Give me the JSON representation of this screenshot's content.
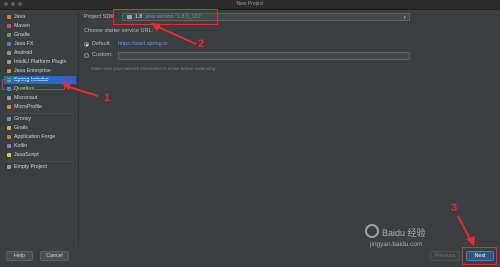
{
  "window": {
    "title": "New Project"
  },
  "sidebar": {
    "items": [
      {
        "label": "Java",
        "color": "#c8843a"
      },
      {
        "label": "Maven",
        "color": "#b85a6e"
      },
      {
        "label": "Gradle",
        "color": "#5a9a6e"
      },
      {
        "label": "Java FX",
        "color": "#5a7ab8"
      },
      {
        "label": "Android",
        "color": "#7ab04a"
      },
      {
        "label": "IntelliJ Platform Plugin",
        "color": "#9a9a9a"
      },
      {
        "label": "Java Enterprise",
        "color": "#d08a3a"
      },
      {
        "label": "Spring Initializr",
        "color": "#6db33f"
      },
      {
        "label": "Quarkus",
        "color": "#4695eb"
      },
      {
        "label": "Micronaut",
        "color": "#9a9a9a"
      },
      {
        "label": "MicroProfile",
        "color": "#d08a3a"
      },
      {
        "label": "Groovy",
        "color": "#5a9ab8"
      },
      {
        "label": "Grails",
        "color": "#d0b03a"
      },
      {
        "label": "Application Forge",
        "color": "#c8843a"
      },
      {
        "label": "Kotlin",
        "color": "#a06ad0"
      },
      {
        "label": "JavaScript",
        "color": "#d0c83a"
      },
      {
        "label": "Empty Project",
        "color": "#9a9a9a"
      }
    ],
    "selected": "Spring Initializr"
  },
  "main": {
    "sdk_label": "Project SDK:",
    "sdk_name": "1.8",
    "sdk_version": "java version \"1.8.0_131\"",
    "starter_label": "Choose starter service URL:",
    "default_label": "Default:",
    "default_url": "https://start.spring.io",
    "custom_label": "Custom:",
    "custom_value": "",
    "note": "Make sure your network connection is active before continuing."
  },
  "buttons": {
    "help": "Help",
    "cancel": "Cancel",
    "previous": "Previous",
    "next": "Next"
  },
  "annotations": {
    "one": "1",
    "two": "2",
    "three": "3"
  },
  "watermark": {
    "brand": "Baidu 经验",
    "url": "jingyan.baidu.com"
  }
}
